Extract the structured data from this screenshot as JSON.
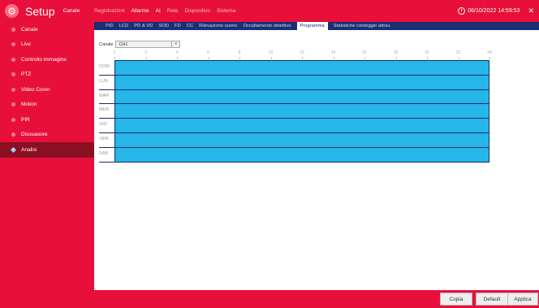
{
  "header": {
    "title": "Setup",
    "crumb": "Canale",
    "nav": [
      {
        "label": "Registrazioni",
        "active": false
      },
      {
        "label": "Allarme",
        "active": true
      },
      {
        "label": "AI",
        "active": true
      },
      {
        "label": "Rete",
        "active": false
      },
      {
        "label": "Dispositivo",
        "active": false
      },
      {
        "label": "Sistema",
        "active": false
      }
    ],
    "datetime": "06/10/2022 14:59:53",
    "close_glyph": "✕"
  },
  "sidebar": {
    "items": [
      {
        "label": "Canale",
        "active": false
      },
      {
        "label": "Live",
        "active": false
      },
      {
        "label": "Controllo immagine",
        "active": false
      },
      {
        "label": "PTZ",
        "active": false
      },
      {
        "label": "Video Cover",
        "active": false
      },
      {
        "label": "Motion",
        "active": false
      },
      {
        "label": "PIR",
        "active": false
      },
      {
        "label": "Dissuasore",
        "active": false
      },
      {
        "label": "Analisi",
        "active": true
      }
    ]
  },
  "subtabs": {
    "items": [
      {
        "label": "PID",
        "active": false
      },
      {
        "label": "LCD",
        "active": false
      },
      {
        "label": "PD & VD",
        "active": false
      },
      {
        "label": "SOD",
        "active": false
      },
      {
        "label": "FD",
        "active": false
      },
      {
        "label": "CC",
        "active": false
      },
      {
        "label": "Rilevazione suono",
        "active": false
      },
      {
        "label": "Occultamento obiettivo",
        "active": false
      },
      {
        "label": "Programma",
        "active": true
      },
      {
        "label": "Statistiche conteggio attrav.",
        "active": false
      }
    ]
  },
  "schedule": {
    "channel_label": "Canale",
    "channel_value": "CH1",
    "hours": [
      "0",
      "2",
      "4",
      "6",
      "8",
      "10",
      "12",
      "14",
      "16",
      "18",
      "20",
      "22",
      "24"
    ],
    "days": [
      "DOM",
      "LUN",
      "MAR",
      "MER",
      "GIO",
      "VEN",
      "SAB"
    ],
    "fill_fraction": 1.0,
    "fill_color": "#25b6ea"
  },
  "footer": {
    "copy_label": "Copia",
    "default_label": "Default",
    "apply_label": "Applica"
  },
  "colors": {
    "accent": "#e8103a",
    "nav_dark": "#1c2f72",
    "sidebar_active": "#8a0f22"
  }
}
